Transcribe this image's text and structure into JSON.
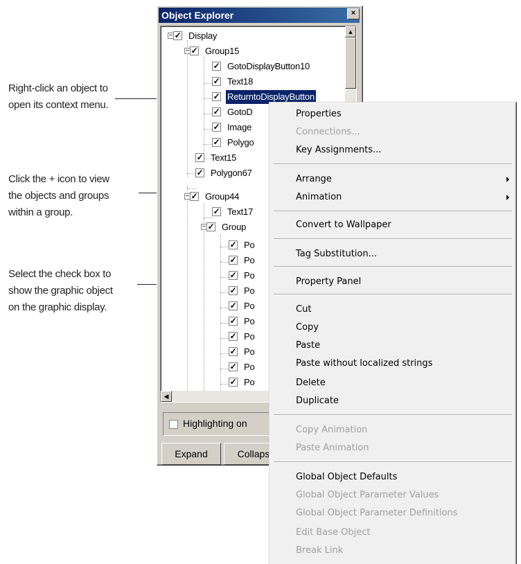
{
  "annotations": [
    {
      "lines": [
        "Right-click an object to",
        "open its context menu."
      ]
    },
    {
      "lines": [
        "Click the + icon to view",
        "the objects and groups",
        "within a group."
      ]
    },
    {
      "lines": [
        "Select the check box to",
        "show the graphic object",
        "on the graphic display."
      ]
    }
  ],
  "explorer": {
    "title": "Object Explorer",
    "close_glyph": "×",
    "tree": [
      {
        "label": "Display"
      },
      {
        "label": "Group15"
      },
      {
        "label": "GotoDisplayButton10"
      },
      {
        "label": "Text18"
      },
      {
        "label": "ReturntoDisplayButton",
        "selected": true
      },
      {
        "label": "GotoD"
      },
      {
        "label": "Image"
      },
      {
        "label": "Polygo"
      },
      {
        "label": "Text15"
      },
      {
        "label": "Polygon67"
      },
      {
        "label": "Group44"
      },
      {
        "label": "Text17"
      },
      {
        "label": "Group"
      },
      {
        "label": "Po"
      },
      {
        "label": "Po"
      },
      {
        "label": "Po"
      },
      {
        "label": "Po"
      },
      {
        "label": "Po"
      },
      {
        "label": "Po"
      },
      {
        "label": "Po"
      },
      {
        "label": "Po"
      },
      {
        "label": "Po"
      },
      {
        "label": "Po"
      }
    ],
    "highlighting_label": "Highlighting on",
    "highlighting_checked": false,
    "buttons": {
      "expand": "Expand",
      "collapse": "Collaps"
    }
  },
  "context_menu": {
    "items": [
      {
        "label": "Properties",
        "disabled": false
      },
      {
        "label": "Connections...",
        "disabled": true
      },
      {
        "label": "Key Assignments...",
        "disabled": false
      },
      {
        "label": "Arrange",
        "disabled": false,
        "submenu": true
      },
      {
        "label": "Animation",
        "disabled": false,
        "submenu": true
      },
      {
        "label": "Convert to Wallpaper",
        "disabled": false
      },
      {
        "label": "Tag Substitution...",
        "disabled": false
      },
      {
        "label": "Property Panel",
        "disabled": false
      },
      {
        "label": "Cut",
        "disabled": false
      },
      {
        "label": "Copy",
        "disabled": false
      },
      {
        "label": "Paste",
        "disabled": false
      },
      {
        "label": "Paste without localized strings",
        "disabled": false
      },
      {
        "label": "Delete",
        "disabled": false
      },
      {
        "label": "Duplicate",
        "disabled": false
      },
      {
        "label": "Copy Animation",
        "disabled": true
      },
      {
        "label": "Paste Animation",
        "disabled": true
      },
      {
        "label": "Global Object Defaults",
        "disabled": false
      },
      {
        "label": "Global Object Parameter Values",
        "disabled": true
      },
      {
        "label": "Global Object Parameter Definitions",
        "disabled": true
      },
      {
        "label": "Edit Base Object",
        "disabled": true
      },
      {
        "label": "Break Link",
        "disabled": true
      }
    ]
  },
  "colors": {
    "title_bar": "#0a246a",
    "selection": "#0a246a",
    "disabled_text": "#a0a0a0",
    "face": "#d4d0c8",
    "menu_bg": "#f0f0f0"
  }
}
